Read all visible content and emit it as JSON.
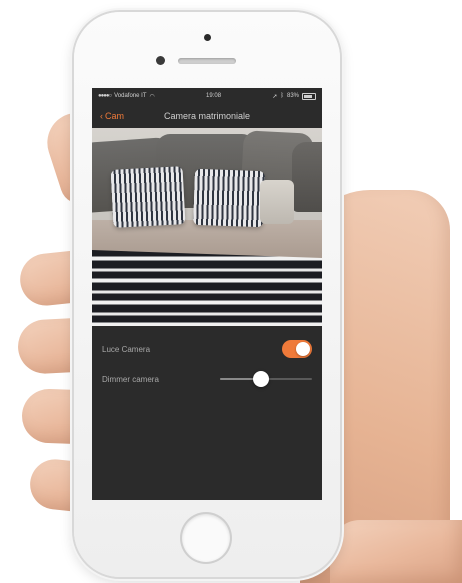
{
  "status_bar": {
    "carrier": "Vodafone IT",
    "time": "19:08",
    "battery": "83%"
  },
  "nav": {
    "back_label": "Cam",
    "title": "Camera matrimoniale"
  },
  "controls": {
    "toggle_label": "Luce Camera",
    "toggle_on": true,
    "slider_label": "Dimmer camera",
    "slider_level": 0.45
  },
  "colors": {
    "accent": "#ef7a3a",
    "screen_background": "#2b2b2b"
  },
  "icons": {
    "back": "chevron-left-icon",
    "wifi": "wifi-icon",
    "battery": "battery-icon"
  }
}
